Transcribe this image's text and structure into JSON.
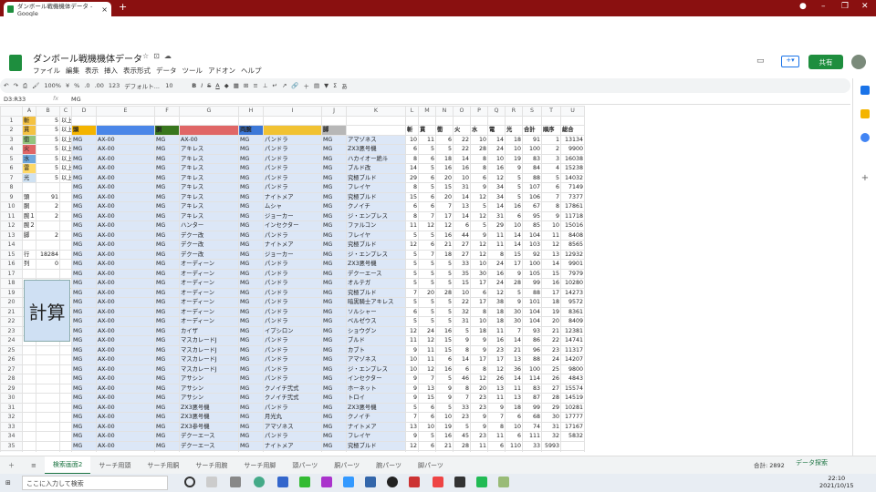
{
  "browser": {
    "tab_title": "ダンボール戦機機体データ - Google",
    "new_tab": "+"
  },
  "doc": {
    "title": "ダンボール戦機機体データ",
    "share": "共有"
  },
  "menu": [
    "ファイル",
    "編集",
    "表示",
    "挿入",
    "表示形式",
    "データ",
    "ツール",
    "アドオン",
    "ヘルプ"
  ],
  "toolbar": {
    "zoom": "100%",
    "currency": "¥",
    "percent": "%",
    "dec0": ".0",
    "dec00": ".00",
    "fmt": "123",
    "font": "デフォルト...",
    "size": "10"
  },
  "formula": {
    "namebox": "D3:R33",
    "fx": "fx",
    "value": "MG"
  },
  "columns": [
    "",
    "A",
    "B",
    "C",
    "D",
    "E",
    "F",
    "G",
    "H",
    "I",
    "J",
    "K",
    "L",
    "M",
    "N",
    "O",
    "P",
    "Q",
    "R",
    "S",
    "T",
    "U"
  ],
  "header": [
    "",
    "",
    "",
    "",
    "頭",
    "",
    "胴",
    "",
    "両腕",
    "",
    "脚",
    "",
    "斬",
    "貫",
    "衝",
    "火",
    "水",
    "電",
    "光",
    "合計",
    "順序",
    "総合"
  ],
  "left": [
    [
      "斬",
      "5",
      "以上"
    ],
    [
      "貫",
      "5",
      "以上"
    ],
    [
      "衝",
      "5",
      "以上"
    ],
    [
      "火",
      "5",
      "以上"
    ],
    [
      "水",
      "5",
      "以上"
    ],
    [
      "雷",
      "5",
      "以上"
    ],
    [
      "光",
      "5",
      "以上"
    ],
    [
      "",
      "",
      " "
    ],
    [
      "頭",
      "91",
      ""
    ],
    [
      "胴",
      "2",
      ""
    ],
    [
      "腕１",
      "2",
      ""
    ],
    [
      "腕２",
      "",
      ""
    ],
    [
      "脚",
      "2",
      ""
    ],
    [
      "",
      "",
      " "
    ],
    [
      "行",
      "18284",
      ""
    ],
    [
      "列",
      "0",
      ""
    ]
  ],
  "rows": [
    [
      "MG",
      "AX-00",
      "MG",
      "AX-00",
      "MG",
      "パンドラ",
      "MG",
      "アマゾネス",
      "10",
      "11",
      "6",
      "22",
      "10",
      "14",
      "18",
      "91",
      "1",
      "13134"
    ],
    [
      "MG",
      "AX-00",
      "MG",
      "アキレス",
      "MG",
      "パンドラ",
      "MG",
      "ZX3悪号機",
      "6",
      "5",
      "5",
      "22",
      "28",
      "24",
      "10",
      "100",
      "2",
      "9900"
    ],
    [
      "MG",
      "AX-00",
      "MG",
      "アキレス",
      "MG",
      "パンドラ",
      "MG",
      "ハカイオー絶斗",
      "8",
      "6",
      "18",
      "14",
      "8",
      "10",
      "19",
      "83",
      "3",
      "16038"
    ],
    [
      "MG",
      "AX-00",
      "MG",
      "アキレス",
      "MG",
      "パンドラ",
      "MG",
      "ブルド改",
      "14",
      "5",
      "16",
      "16",
      "8",
      "16",
      "9",
      "84",
      "4",
      "15238"
    ],
    [
      "MG",
      "AX-00",
      "MG",
      "アキレス",
      "MG",
      "パンドラ",
      "MG",
      "究極ブルド",
      "29",
      "6",
      "20",
      "10",
      "6",
      "12",
      "5",
      "88",
      "5",
      "14032"
    ],
    [
      "MG",
      "AX-00",
      "MG",
      "アキレス",
      "MG",
      "パンドラ",
      "MG",
      "フレイヤ",
      "8",
      "5",
      "15",
      "31",
      "9",
      "34",
      "5",
      "107",
      "6",
      "7149"
    ],
    [
      "MG",
      "AX-00",
      "MG",
      "アキレス",
      "MG",
      "ナイトメア",
      "MG",
      "究極ブルド",
      "15",
      "6",
      "20",
      "14",
      "12",
      "34",
      "5",
      "106",
      "7",
      "7377"
    ],
    [
      "MG",
      "AX-00",
      "MG",
      "アキレス",
      "MG",
      "ムシャ",
      "MG",
      "クノイチ",
      "6",
      "6",
      "7",
      "13",
      "5",
      "14",
      "16",
      "67",
      "8",
      "17861"
    ],
    [
      "MG",
      "AX-00",
      "MG",
      "アキレス",
      "MG",
      "ジョーカー",
      "MG",
      "ジ・エンプレス",
      "8",
      "7",
      "17",
      "14",
      "12",
      "31",
      "6",
      "95",
      "9",
      "11718"
    ],
    [
      "MG",
      "AX-00",
      "MG",
      "ハンター",
      "MG",
      "インセクター",
      "MG",
      "ファルコン",
      "11",
      "12",
      "12",
      "6",
      "5",
      "29",
      "10",
      "85",
      "10",
      "15016"
    ],
    [
      "MG",
      "AX-00",
      "MG",
      "デクー改",
      "MG",
      "パンドラ",
      "MG",
      "フレイヤ",
      "5",
      "5",
      "16",
      "44",
      "9",
      "11",
      "14",
      "104",
      "11",
      "8408"
    ],
    [
      "MG",
      "AX-00",
      "MG",
      "デクー改",
      "MG",
      "ナイトメア",
      "MG",
      "究極ブルド",
      "12",
      "6",
      "21",
      "27",
      "12",
      "11",
      "14",
      "103",
      "12",
      "8565"
    ],
    [
      "MG",
      "AX-00",
      "MG",
      "デクー改",
      "MG",
      "ジョーカー",
      "MG",
      "ジ・エンプレス",
      "5",
      "7",
      "18",
      "27",
      "12",
      "8",
      "15",
      "92",
      "13",
      "12932"
    ],
    [
      "MG",
      "AX-00",
      "MG",
      "オーディーン",
      "MG",
      "パンドラ",
      "MG",
      "ZX3悪号機",
      "5",
      "5",
      "5",
      "33",
      "10",
      "24",
      "17",
      "100",
      "14",
      "9901"
    ],
    [
      "MG",
      "AX-00",
      "MG",
      "オーディーン",
      "MG",
      "パンドラ",
      "MG",
      "デクーエース",
      "5",
      "5",
      "5",
      "35",
      "30",
      "16",
      "9",
      "105",
      "15",
      "7979"
    ],
    [
      "MG",
      "AX-00",
      "MG",
      "オーディーン",
      "MG",
      "パンドラ",
      "MG",
      "オルテガ",
      "5",
      "5",
      "5",
      "15",
      "17",
      "24",
      "28",
      "99",
      "16",
      "10280"
    ],
    [
      "MG",
      "AX-00",
      "MG",
      "オーディーン",
      "MG",
      "パンドラ",
      "MG",
      "究極ブルド",
      "7",
      "20",
      "28",
      "10",
      "6",
      "12",
      "5",
      "88",
      "17",
      "14273"
    ],
    [
      "MG",
      "AX-00",
      "MG",
      "オーディーン",
      "MG",
      "パンドラ",
      "MG",
      "暗黒騎士アキレス",
      "5",
      "5",
      "5",
      "22",
      "17",
      "38",
      "9",
      "101",
      "18",
      "9572"
    ],
    [
      "MG",
      "AX-00",
      "MG",
      "オーディーン",
      "MG",
      "パンドラ",
      "MG",
      "ソルシャー",
      "6",
      "5",
      "5",
      "32",
      "8",
      "18",
      "30",
      "104",
      "19",
      "8361"
    ],
    [
      "MG",
      "AX-00",
      "MG",
      "オーディーン",
      "MG",
      "パンドラ",
      "MG",
      "ベルゼウス",
      "5",
      "5",
      "5",
      "31",
      "10",
      "18",
      "30",
      "104",
      "20",
      "8409"
    ],
    [
      "MG",
      "AX-00",
      "MG",
      "カイザ",
      "MG",
      "イプシロン",
      "MG",
      "ショウグン",
      "12",
      "24",
      "16",
      "5",
      "18",
      "11",
      "7",
      "93",
      "21",
      "12381"
    ],
    [
      "MG",
      "AX-00",
      "MG",
      "マスカレードJ",
      "MG",
      "パンドラ",
      "MG",
      "ブルド",
      "11",
      "12",
      "15",
      "9",
      "9",
      "16",
      "14",
      "86",
      "22",
      "14741"
    ],
    [
      "MG",
      "AX-00",
      "MG",
      "マスカレードJ",
      "MG",
      "パンドラ",
      "MG",
      "カブト",
      "9",
      "11",
      "15",
      "8",
      "9",
      "23",
      "21",
      "96",
      "23",
      "11317"
    ],
    [
      "MG",
      "AX-00",
      "MG",
      "マスカレードJ",
      "MG",
      "パンドラ",
      "MG",
      "アマゾネス",
      "10",
      "11",
      "6",
      "14",
      "17",
      "17",
      "13",
      "88",
      "24",
      "14207"
    ],
    [
      "MG",
      "AX-00",
      "MG",
      "マスカレードJ",
      "MG",
      "パンドラ",
      "MG",
      "ジ・エンプレス",
      "10",
      "12",
      "16",
      "6",
      "8",
      "12",
      "36",
      "100",
      "25",
      "9800"
    ],
    [
      "MG",
      "AX-00",
      "MG",
      "アサシン",
      "MG",
      "パンドラ",
      "MG",
      "インセクター",
      "9",
      "7",
      "5",
      "46",
      "12",
      "26",
      "14",
      "114",
      "26",
      "4843"
    ],
    [
      "MG",
      "AX-00",
      "MG",
      "アサシン",
      "MG",
      "クノイチ弐式",
      "MG",
      "ホーネット",
      "9",
      "13",
      "9",
      "8",
      "20",
      "13",
      "11",
      "83",
      "27",
      "15574"
    ],
    [
      "MG",
      "AX-00",
      "MG",
      "アサシン",
      "MG",
      "クノイチ弐式",
      "MG",
      "トロイ",
      "9",
      "15",
      "9",
      "7",
      "23",
      "11",
      "13",
      "87",
      "28",
      "14519"
    ],
    [
      "MG",
      "AX-00",
      "MG",
      "ZX3悪号機",
      "MG",
      "パンドラ",
      "MG",
      "ZX3悪号機",
      "5",
      "6",
      "5",
      "33",
      "23",
      "9",
      "18",
      "99",
      "29",
      "10281"
    ],
    [
      "MG",
      "AX-00",
      "MG",
      "ZX3悪号機",
      "MG",
      "月光丸",
      "MG",
      "クノイチ",
      "7",
      "6",
      "10",
      "23",
      "9",
      "7",
      "6",
      "68",
      "30",
      "17777"
    ],
    [
      "MG",
      "AX-00",
      "MG",
      "ZX3参号機",
      "MG",
      "アマゾネス",
      "MG",
      "ナイトメア",
      "13",
      "10",
      "19",
      "5",
      "9",
      "8",
      "10",
      "74",
      "31",
      "17167"
    ],
    [
      "MG",
      "AX-00",
      "MG",
      "デクーエース",
      "MG",
      "パンドラ",
      "MG",
      "フレイヤ",
      "9",
      "5",
      "16",
      "45",
      "23",
      "11",
      "6",
      "111",
      "32",
      "5832"
    ],
    [
      "MG",
      "AX-00",
      "MG",
      "デクーエース",
      "MG",
      "ナイトメア",
      "MG",
      "究極ブルド",
      "12",
      "6",
      "21",
      "28",
      "11",
      "6",
      "110",
      "33",
      "5993",
      ""
    ]
  ],
  "keisan": "計算",
  "sheet_tabs": [
    "検索画面2",
    "サーチ用頭",
    "サーチ用胴",
    "サーチ用腕",
    "サーチ用脚",
    "頭パーツ",
    "胴パーツ",
    "腕パーツ",
    "脚パーツ"
  ],
  "sum": "合計: 2892",
  "explore": "データ探索",
  "taskbar": {
    "search": "ここに入力して検索",
    "time": "22:10",
    "date": "2021/10/15"
  },
  "colors": {
    "chrome": "#8a1010",
    "green": "#1e8e3e",
    "blue_cells": "#dce7f7"
  }
}
